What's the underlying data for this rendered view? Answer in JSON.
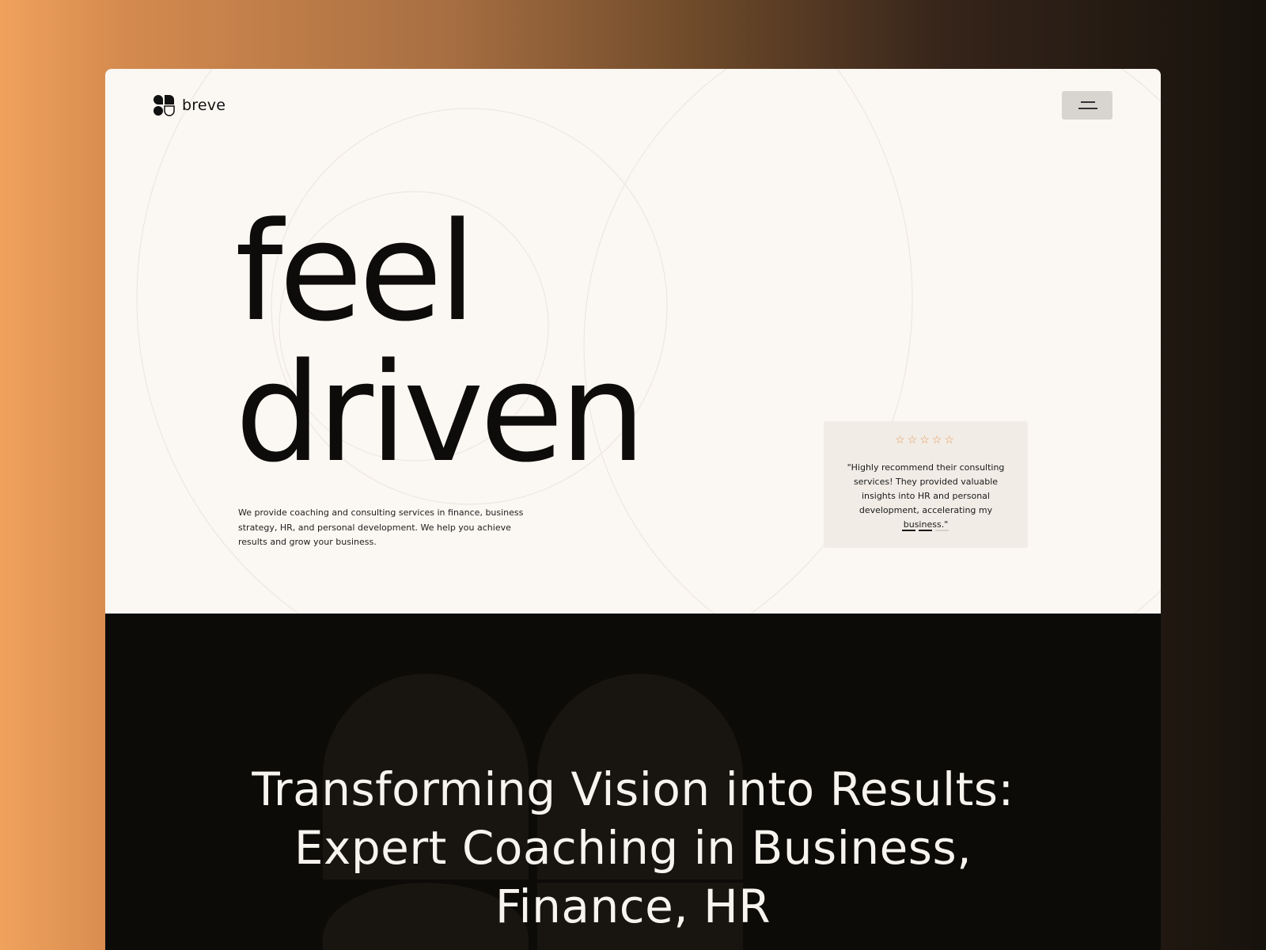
{
  "brand": {
    "name": "breve",
    "icon": "breve-logo-mark"
  },
  "header": {
    "menu_icon": "hamburger-menu-icon"
  },
  "hero": {
    "headline_line1": "feel",
    "headline_line2": "driven",
    "description": "We provide coaching and consulting services in finance, business strategy, HR, and personal development. We help you achieve results and grow your business."
  },
  "testimonial": {
    "rating_display": "☆☆☆☆☆",
    "quote": "\"Highly recommend their consulting services! They provided valuable insights into HR and personal development, accelerating my business.\"",
    "slides_total": 3,
    "active_slides": 2
  },
  "section": {
    "title": "Transforming Vision into Results: Expert Coaching in Business, Finance, HR"
  },
  "colors": {
    "hero_background": "#fbf7f2",
    "dark_background": "#0c0b08",
    "accent_orange": "#e79a5a",
    "card_background": "#f1ece6",
    "menu_button": "#d8d5d1"
  }
}
